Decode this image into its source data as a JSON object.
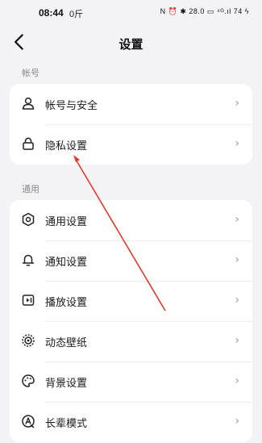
{
  "status_bar": {
    "time": "08:44",
    "extra": "0斤",
    "icons": "N ⏰ ✱ 28.0 ▭ ⁴ᴳ.ıl 74 ϟ"
  },
  "header": {
    "back_icon": "back-arrow-icon",
    "title": "设置"
  },
  "sections": [
    {
      "title": "帐号",
      "items": [
        {
          "label": "帐号与安全",
          "icon": "person-icon"
        },
        {
          "label": "隐私设置",
          "icon": "lock-icon"
        }
      ]
    },
    {
      "title": "通用",
      "items": [
        {
          "label": "通用设置",
          "icon": "gear-icon"
        },
        {
          "label": "通知设置",
          "icon": "bell-icon"
        },
        {
          "label": "播放设置",
          "icon": "play-settings-icon"
        },
        {
          "label": "动态壁纸",
          "icon": "wallpaper-icon"
        },
        {
          "label": "背景设置",
          "icon": "palette-icon"
        },
        {
          "label": "长辈模式",
          "icon": "elder-mode-icon"
        }
      ]
    }
  ],
  "chevron": "›",
  "annotation_color": "#e03a2f"
}
